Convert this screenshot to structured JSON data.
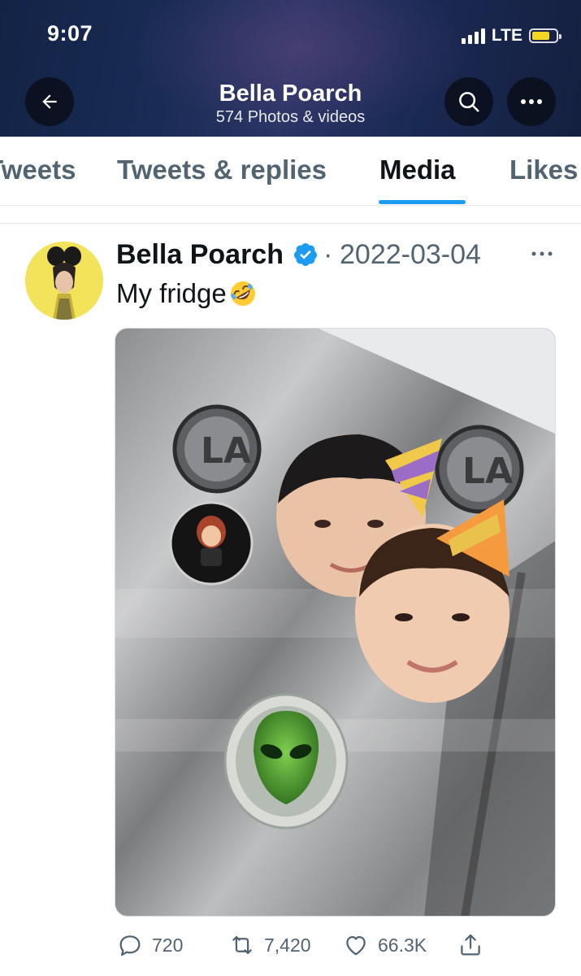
{
  "status_bar": {
    "time": "9:07",
    "network": "LTE",
    "battery_level": 0.75,
    "battery_color": "#f5d623"
  },
  "header": {
    "back_icon": "arrow-left-icon",
    "title": "Bella Poarch",
    "subtitle": "574 Photos & videos",
    "search_icon": "search-icon",
    "more_icon": "more-horizontal-icon"
  },
  "tabs": [
    {
      "label": "Tweets",
      "active": false
    },
    {
      "label": "Tweets & replies",
      "active": false
    },
    {
      "label": "Media",
      "active": true
    },
    {
      "label": "Likes",
      "active": false
    }
  ],
  "tweet": {
    "author": "Bella Poarch",
    "verified": true,
    "separator": "·",
    "date": "2022-03-04",
    "text": "My fridge",
    "emoji": "rolling-on-floor-laughing-emoji",
    "media_icon": "photo",
    "actions": {
      "replies": "720",
      "retweets": "7,420",
      "likes": "66.3K"
    }
  },
  "colors": {
    "accent": "#1d9bf0",
    "text_primary": "#0f1419",
    "text_secondary": "#536471"
  }
}
